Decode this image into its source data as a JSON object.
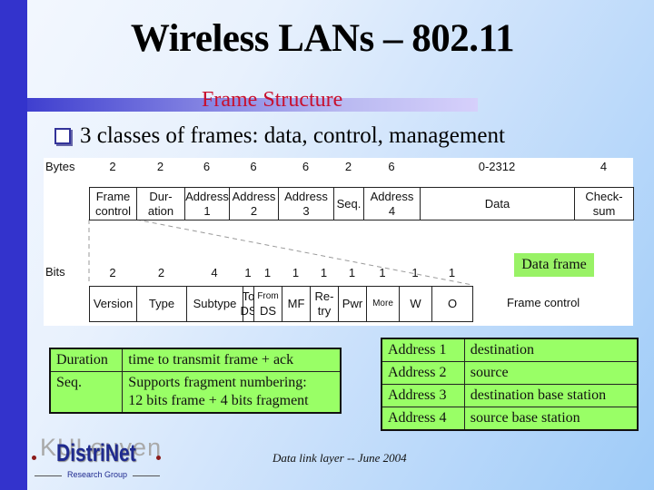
{
  "slide": {
    "title": "Wireless LANs – 802.11",
    "subtitle": "Frame Structure",
    "bullet": "3 classes of frames: data, control, management",
    "footer": "Data link  layer  --  June 2004"
  },
  "diagram": {
    "bytes_label": "Bytes",
    "bits_label": "Bits",
    "badge": "Data frame",
    "frame_control_label": "Frame control",
    "frame_fields": [
      {
        "size": "2",
        "line1": "Frame",
        "line2": "control"
      },
      {
        "size": "2",
        "line1": "Dur-",
        "line2": "ation"
      },
      {
        "size": "6",
        "line1": "Address",
        "line2": "1"
      },
      {
        "size": "6",
        "line1": "Address",
        "line2": "2"
      },
      {
        "size": "6",
        "line1": "Address",
        "line2": "3"
      },
      {
        "size": "2",
        "line1": "Seq.",
        "line2": ""
      },
      {
        "size": "6",
        "line1": "Address",
        "line2": "4"
      },
      {
        "size": "0-2312",
        "line1": "Data",
        "line2": ""
      },
      {
        "size": "4",
        "line1": "Check-",
        "line2": "sum"
      }
    ],
    "control_fields": [
      {
        "size": "2",
        "line1": "Version",
        "line2": ""
      },
      {
        "size": "2",
        "line1": "Type",
        "line2": ""
      },
      {
        "size": "4",
        "line1": "Subtype",
        "line2": ""
      },
      {
        "size": "1",
        "line1": "To",
        "line2": "DS"
      },
      {
        "size": "1",
        "line1": "From",
        "line2": "DS"
      },
      {
        "size": "1",
        "line1": "MF",
        "line2": ""
      },
      {
        "size": "1",
        "line1": "Re-",
        "line2": "try"
      },
      {
        "size": "1",
        "line1": "Pwr",
        "line2": ""
      },
      {
        "size": "1",
        "line1": "More",
        "line2": ""
      },
      {
        "size": "1",
        "line1": "W",
        "line2": ""
      },
      {
        "size": "1",
        "line1": "O",
        "line2": ""
      }
    ]
  },
  "left_table": [
    {
      "field": "Duration",
      "desc": "time to transmit frame + ack"
    },
    {
      "field": "Seq.",
      "desc": "Supports fragment  numbering:\n12 bits frame + 4 bits fragment"
    }
  ],
  "right_table": [
    {
      "field": "Address 1",
      "desc": "destination"
    },
    {
      "field": "Address 2",
      "desc": "source"
    },
    {
      "field": "Address 3",
      "desc": "destination base station"
    },
    {
      "field": "Address 4",
      "desc": "source base station"
    }
  ],
  "logo": {
    "overlay": "KULeuven",
    "name": "DistriNet",
    "tagline": "Research Group"
  },
  "colors": {
    "sidebar": "#3333cc",
    "subtitle": "#c8102e",
    "table_fill": "#99ff66",
    "badge_fill": "#99f266"
  }
}
